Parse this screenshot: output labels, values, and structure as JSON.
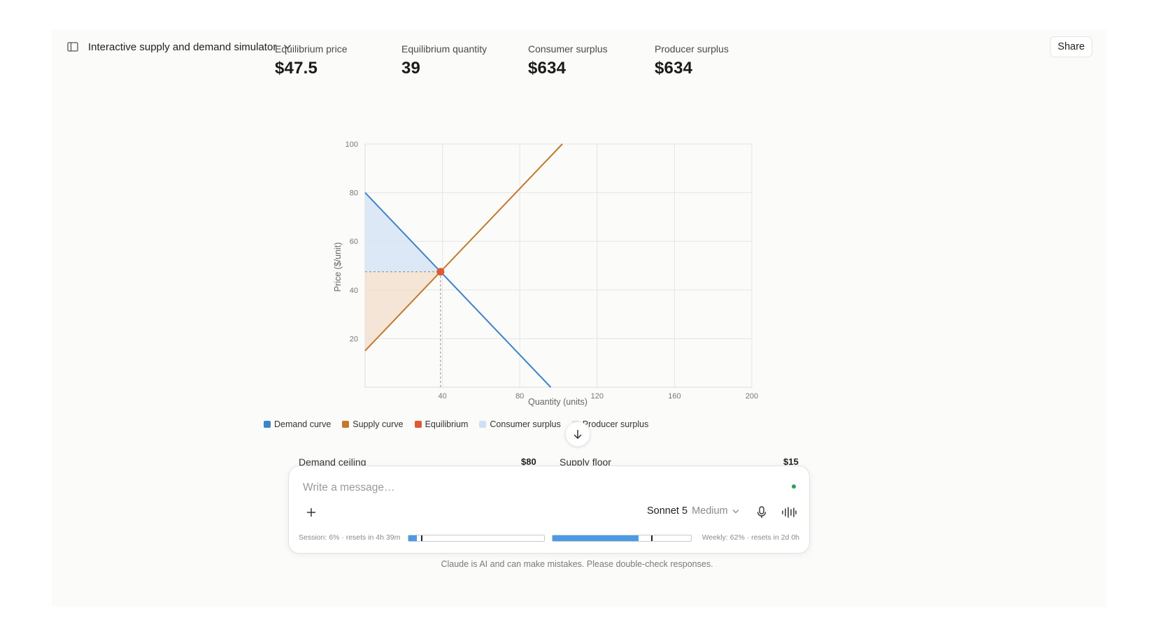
{
  "header": {
    "title": "Interactive supply and demand simulator",
    "share_label": "Share"
  },
  "stats": [
    {
      "label": "Equilibrium price",
      "value": "$47.5"
    },
    {
      "label": "Equilibrium quantity",
      "value": "39"
    },
    {
      "label": "Consumer surplus",
      "value": "$634"
    },
    {
      "label": "Producer surplus",
      "value": "$634"
    }
  ],
  "chart_data": {
    "type": "line",
    "xlabel": "Quantity (units)",
    "ylabel": "Price ($/unit)",
    "xlim": [
      0,
      200
    ],
    "ylim": [
      0,
      100
    ],
    "xticks": [
      40,
      80,
      120,
      160,
      200
    ],
    "yticks": [
      20,
      40,
      60,
      80,
      100
    ],
    "grid": true,
    "series": [
      {
        "name": "Demand curve",
        "color": "#3f84c9",
        "points": [
          [
            0,
            80
          ],
          [
            96,
            0
          ]
        ]
      },
      {
        "name": "Supply curve",
        "color": "#c07a2a",
        "points": [
          [
            0,
            15
          ],
          [
            102,
            100
          ]
        ]
      }
    ],
    "equilibrium": {
      "name": "Equilibrium",
      "color": "#dd5a33",
      "x": 39,
      "y": 47.5
    },
    "areas": [
      {
        "name": "Consumer surplus",
        "color": "#cfe0f4"
      },
      {
        "name": "Producer surplus",
        "color": "#f1dcc6"
      }
    ],
    "legend_position": "bottom"
  },
  "controls": {
    "demand_ceiling_label": "Demand ceiling",
    "demand_ceiling_value": "$80",
    "supply_floor_label": "Supply floor",
    "supply_floor_value": "$15"
  },
  "composer": {
    "placeholder": "Write a message…",
    "model_name": "Sonnet 5",
    "model_effort": "Medium",
    "session_usage_text": "Session: 6% · resets in 4h 39m",
    "session_usage_fraction": 0.06,
    "weekly_usage_text": "Weekly: 62% · resets in 2d 0h",
    "weekly_usage_fraction": 0.62
  },
  "footer": {
    "disclaimer": "Claude is AI and can make mistakes. Please double-check responses."
  },
  "icons": {
    "sidebar": "sidebar-toggle-icon",
    "title_chevron": "chevron-down-icon",
    "scroll_down": "arrow-down-icon",
    "plus": "plus-icon",
    "model_chevron": "chevron-down-icon",
    "mic": "microphone-icon",
    "voice": "voice-waveform-icon"
  }
}
